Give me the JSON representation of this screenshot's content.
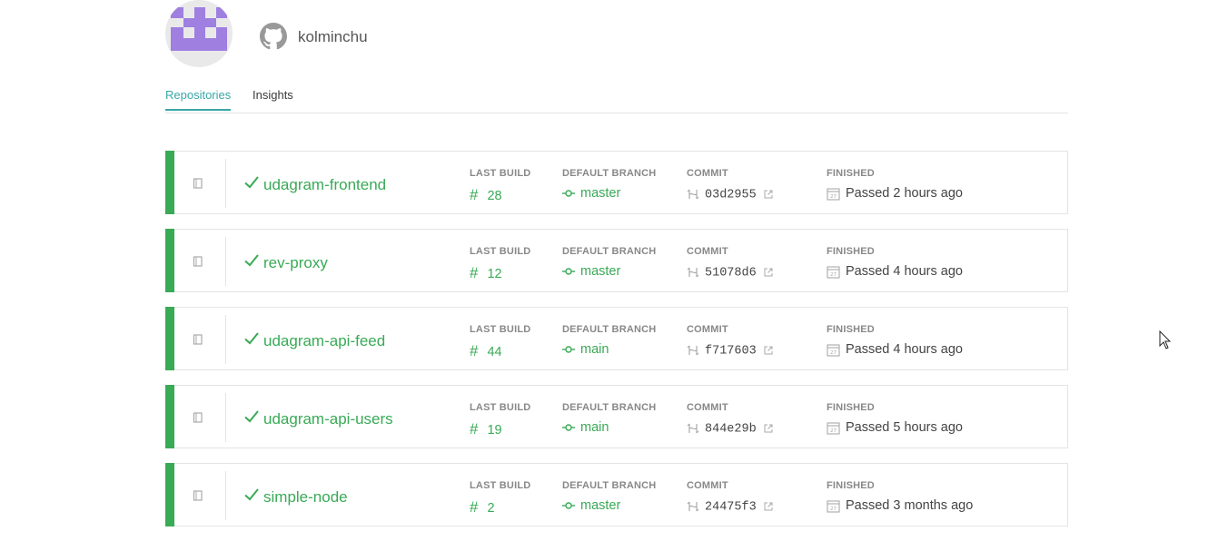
{
  "profile": {
    "username": "kolminchu"
  },
  "tabs": [
    {
      "label": "Repositories",
      "active": true
    },
    {
      "label": "Insights",
      "active": false
    }
  ],
  "columns": {
    "last_build": "LAST BUILD",
    "default_branch": "DEFAULT BRANCH",
    "commit": "COMMIT",
    "finished": "FINISHED"
  },
  "repos": [
    {
      "name": "udagram-frontend",
      "build": "28",
      "branch": "master",
      "commit": "03d2955",
      "finished": "Passed 2 hours ago",
      "status": "passed"
    },
    {
      "name": "rev-proxy",
      "build": "12",
      "branch": "master",
      "commit": "51078d6",
      "finished": "Passed 4 hours ago",
      "status": "passed"
    },
    {
      "name": "udagram-api-feed",
      "build": "44",
      "branch": "main",
      "commit": "f717603",
      "finished": "Passed 4 hours ago",
      "status": "passed"
    },
    {
      "name": "udagram-api-users",
      "build": "19",
      "branch": "main",
      "commit": "844e29b",
      "finished": "Passed 5 hours ago",
      "status": "passed"
    },
    {
      "name": "simple-node",
      "build": "2",
      "branch": "master",
      "commit": "24475f3",
      "finished": "Passed 3 months ago",
      "status": "passed"
    }
  ],
  "colors": {
    "passed": "#39aa56",
    "accent": "#3ba6a6",
    "avatar": "#9f7fdf"
  }
}
